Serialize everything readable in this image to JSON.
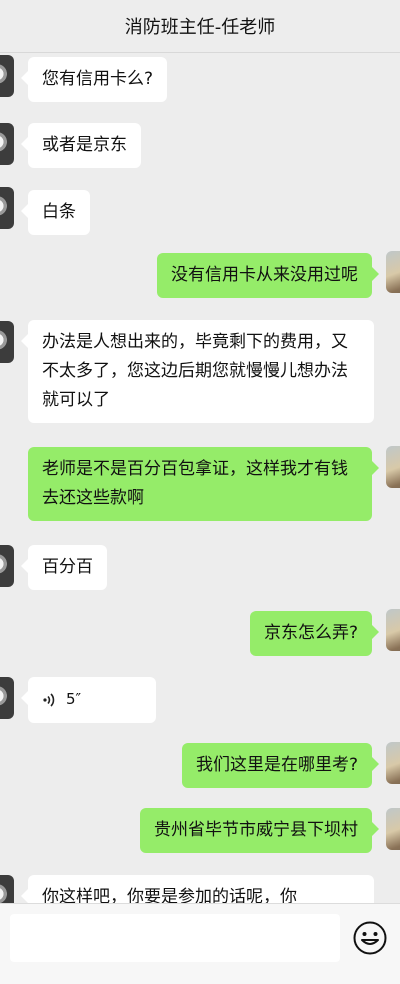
{
  "header": {
    "title": "消防班主任-任老师"
  },
  "messages": [
    {
      "side": "in",
      "text": "您有信用卡么?"
    },
    {
      "side": "in",
      "text": "或者是京东"
    },
    {
      "side": "in",
      "text": "白条"
    },
    {
      "side": "out",
      "text": "没有信用卡从来没用过呢"
    },
    {
      "side": "in",
      "text": "办法是人想出来的，毕竟剩下的费用，又不太多了，您这边后期您就慢慢儿想办法就可以了"
    },
    {
      "side": "out",
      "text": "老师是不是百分百包拿证，这样我才有钱去还这些款啊"
    },
    {
      "side": "in",
      "text": "百分百"
    },
    {
      "side": "out",
      "text": "京东怎么弄?"
    },
    {
      "side": "in",
      "type": "voice",
      "duration": "5″"
    },
    {
      "side": "out",
      "text": "我们这里是在哪里考?"
    },
    {
      "side": "out",
      "text": "贵州省毕节市威宁县下坝村"
    },
    {
      "side": "in",
      "text": "你这样吧，你要是参加的话呢，你"
    }
  ],
  "input": {
    "placeholder": ""
  },
  "icons": {
    "emoji": "smiley-face-icon",
    "voice": "voice-wave-icon"
  },
  "colors": {
    "out_bubble": "#95ec69",
    "in_bubble": "#ffffff",
    "background": "#ededed"
  }
}
